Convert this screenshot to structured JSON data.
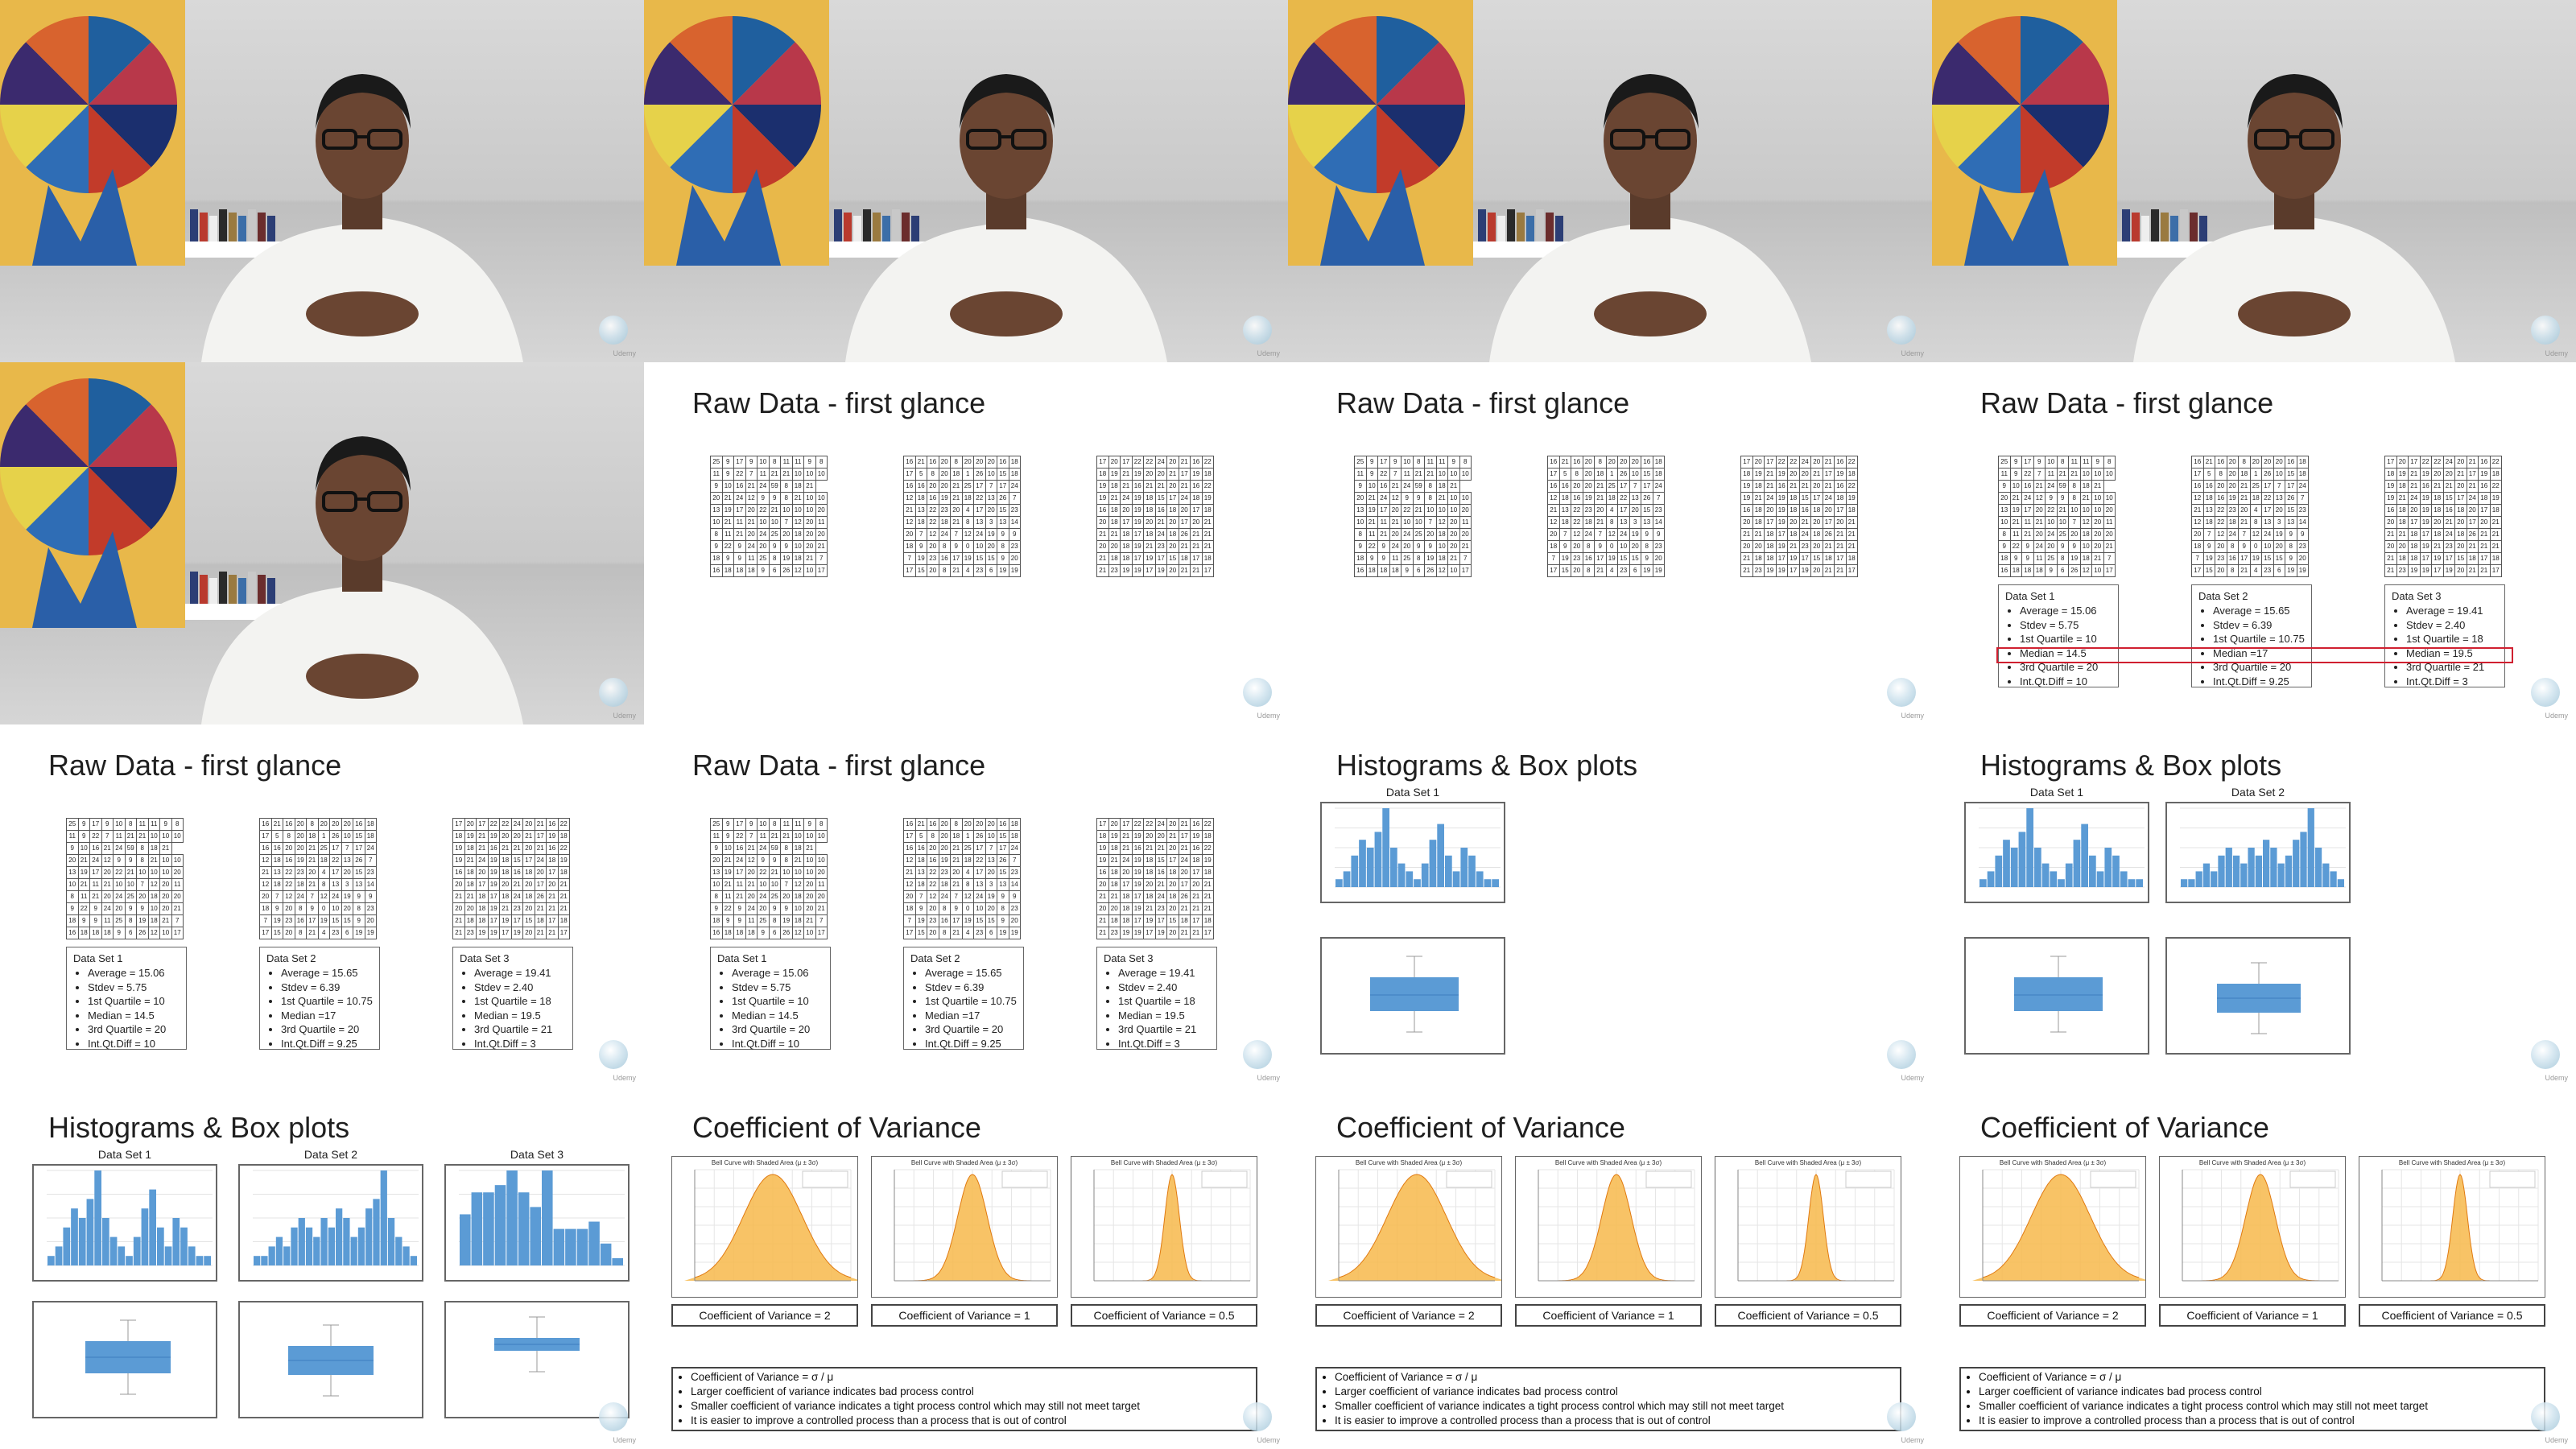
{
  "colors": {
    "bar": "#5b9bd5",
    "bell": "#f7b84b",
    "highlight": "#d02030",
    "curve": "#e07a10"
  },
  "icons": {
    "brand": "udemy-logo-icon"
  },
  "watermark": "Udemy",
  "tables": {
    "set1": [
      [
        "25",
        "9",
        "17",
        "9",
        "10",
        "8",
        "11",
        "11",
        "9",
        "8"
      ],
      [
        "11",
        "9",
        "22",
        "7",
        "11",
        "21",
        "21",
        "10",
        "10",
        "10"
      ],
      [
        "9",
        "10",
        "16",
        "21",
        "24",
        "59",
        "8",
        "18",
        "21"
      ],
      [
        "20",
        "21",
        "24",
        "12",
        "9",
        "9",
        "8",
        "21",
        "10",
        "10"
      ],
      [
        "13",
        "19",
        "17",
        "20",
        "22",
        "21",
        "10",
        "10",
        "10",
        "20"
      ],
      [
        "10",
        "21",
        "11",
        "21",
        "10",
        "10",
        "7",
        "12",
        "20",
        "11"
      ],
      [
        "8",
        "11",
        "21",
        "20",
        "24",
        "25",
        "20",
        "18",
        "20",
        "20"
      ],
      [
        "9",
        "22",
        "9",
        "24",
        "20",
        "9",
        "9",
        "10",
        "20",
        "21"
      ],
      [
        "18",
        "9",
        "9",
        "11",
        "25",
        "8",
        "19",
        "18",
        "21",
        "7"
      ],
      [
        "16",
        "18",
        "18",
        "18",
        "9",
        "6",
        "26",
        "12",
        "10",
        "17"
      ]
    ],
    "set2": [
      [
        "16",
        "21",
        "16",
        "20",
        "8",
        "20",
        "20",
        "20",
        "16",
        "18"
      ],
      [
        "17",
        "5",
        "8",
        "20",
        "18",
        "1",
        "26",
        "10",
        "15",
        "18"
      ],
      [
        "16",
        "16",
        "20",
        "20",
        "21",
        "25",
        "17",
        "7",
        "17",
        "24"
      ],
      [
        "12",
        "18",
        "16",
        "19",
        "21",
        "18",
        "22",
        "13",
        "26",
        "7"
      ],
      [
        "21",
        "13",
        "22",
        "23",
        "20",
        "4",
        "17",
        "20",
        "15",
        "23"
      ],
      [
        "12",
        "18",
        "22",
        "18",
        "21",
        "8",
        "13",
        "3",
        "13",
        "14"
      ],
      [
        "20",
        "7",
        "12",
        "24",
        "7",
        "12",
        "24",
        "19",
        "9",
        "9"
      ],
      [
        "18",
        "9",
        "20",
        "8",
        "9",
        "0",
        "10",
        "20",
        "8",
        "23"
      ],
      [
        "7",
        "19",
        "23",
        "16",
        "17",
        "19",
        "15",
        "15",
        "9",
        "20"
      ],
      [
        "17",
        "15",
        "20",
        "8",
        "21",
        "4",
        "23",
        "6",
        "19",
        "19"
      ]
    ],
    "set3": [
      [
        "17",
        "20",
        "17",
        "22",
        "22",
        "24",
        "20",
        "21",
        "16",
        "22"
      ],
      [
        "18",
        "19",
        "21",
        "19",
        "20",
        "20",
        "21",
        "17",
        "19",
        "18"
      ],
      [
        "19",
        "18",
        "21",
        "16",
        "21",
        "21",
        "20",
        "21",
        "16",
        "22"
      ],
      [
        "19",
        "21",
        "24",
        "19",
        "18",
        "15",
        "17",
        "24",
        "18",
        "19"
      ],
      [
        "16",
        "18",
        "20",
        "19",
        "18",
        "16",
        "18",
        "20",
        "17",
        "18"
      ],
      [
        "20",
        "18",
        "17",
        "19",
        "20",
        "21",
        "20",
        "17",
        "20",
        "21"
      ],
      [
        "21",
        "21",
        "18",
        "17",
        "18",
        "24",
        "18",
        "26",
        "21",
        "21"
      ],
      [
        "20",
        "20",
        "18",
        "19",
        "21",
        "23",
        "20",
        "21",
        "21",
        "21"
      ],
      [
        "21",
        "18",
        "18",
        "17",
        "19",
        "17",
        "15",
        "18",
        "17",
        "18"
      ],
      [
        "21",
        "23",
        "19",
        "19",
        "17",
        "19",
        "20",
        "21",
        "21",
        "17"
      ]
    ]
  },
  "slides": {
    "raw_title": "Raw Data - first glance",
    "hist_title": "Histograms & Box plots",
    "cov_title": "Coefficient of Variance",
    "hist_labels": [
      "Data Set 1",
      "Data Set 2",
      "Data Set 3"
    ],
    "stats": [
      {
        "name": "Data Set 1",
        "items": [
          "Average = 15.06",
          "Stdev = 5.75",
          "1st Quartile = 10",
          "Median = 14.5",
          "3rd Quartile = 20",
          "Int.Qt.Diff = 10"
        ]
      },
      {
        "name": "Data Set 2",
        "items": [
          "Average = 15.65",
          "Stdev = 6.39",
          "1st Quartile = 10.75",
          "Median =17",
          "3rd Quartile = 20",
          "Int.Qt.Diff = 9.25"
        ]
      },
      {
        "name": "Data Set 3",
        "items": [
          "Average = 19.41",
          "Stdev = 2.40",
          "1st Quartile = 18",
          "Median = 19.5",
          "3rd Quartile = 21",
          "Int.Qt.Diff = 3"
        ]
      }
    ],
    "bell_title": "Bell Curve with Shaded Area (μ ± 3σ)",
    "cov_captions": [
      "Coefficient of Variance = 2",
      "Coefficient of Variance = 1",
      "Coefficient of Variance = 0.5"
    ],
    "cov_notes": [
      "Coefficient of Variance = σ / μ",
      "Larger coefficient of variance indicates bad process control",
      "Smaller coefficient of variance indicates a tight process control which may still not meet target",
      "It is easier to improve a controlled process than a process that is out of control"
    ]
  },
  "chart_data": [
    {
      "type": "bar",
      "title": "Data Set 1",
      "values": [
        1,
        2,
        4,
        6,
        5,
        7,
        10,
        5,
        3,
        2,
        1,
        3,
        6,
        8,
        4,
        2,
        5,
        4,
        2,
        1,
        1
      ]
    },
    {
      "type": "bar",
      "title": "Data Set 2",
      "values": [
        1,
        1,
        2,
        3,
        2,
        4,
        5,
        4,
        3,
        5,
        4,
        6,
        5,
        3,
        4,
        6,
        7,
        10,
        5,
        3,
        2,
        1
      ]
    },
    {
      "type": "bar",
      "title": "Data Set 3",
      "values": [
        7,
        10,
        10,
        11,
        13,
        10,
        8,
        13,
        5,
        5,
        5,
        6,
        3,
        1
      ]
    }
  ]
}
